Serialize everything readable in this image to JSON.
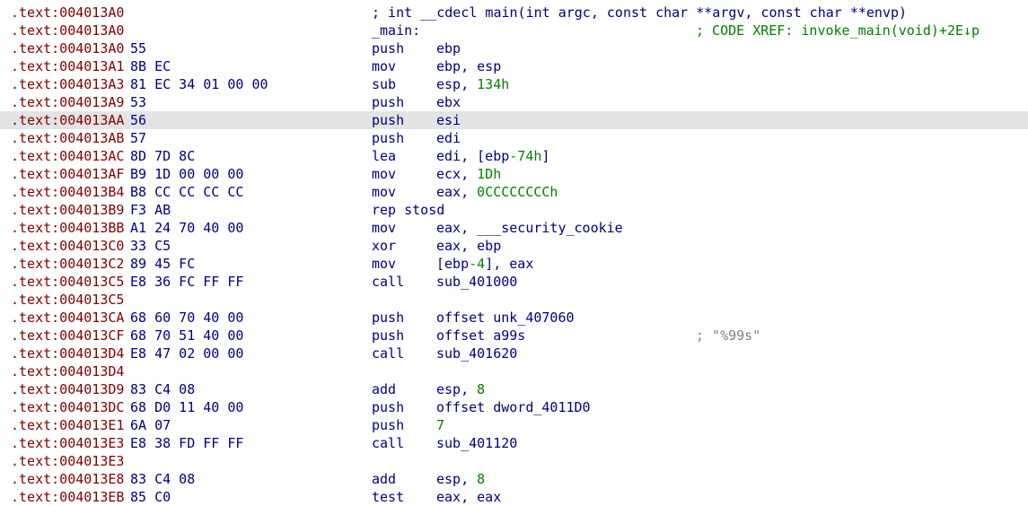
{
  "lines": [
    {
      "addr": ".text:004013A0",
      "bytes": "",
      "kind": "comment",
      "text": "; int __cdecl main(int argc, const char **argv, const char **envp)"
    },
    {
      "addr": ".text:004013A0",
      "bytes": "",
      "kind": "label",
      "text": "_main:",
      "xref": "; CODE XREF: invoke_main(void)+2E↓p"
    },
    {
      "addr": ".text:004013A0",
      "bytes": "55",
      "mnem": "push",
      "ops": [
        {
          "t": "ebp"
        }
      ]
    },
    {
      "addr": ".text:004013A1",
      "bytes": "8B EC",
      "mnem": "mov",
      "ops": [
        {
          "t": "ebp, esp"
        }
      ]
    },
    {
      "addr": ".text:004013A3",
      "bytes": "81 EC 34 01 00 00",
      "mnem": "sub",
      "ops": [
        {
          "t": "esp, "
        },
        {
          "t": "134h",
          "num": true
        }
      ]
    },
    {
      "addr": ".text:004013A9",
      "bytes": "53",
      "mnem": "push",
      "ops": [
        {
          "t": "ebx"
        }
      ]
    },
    {
      "addr": ".text:004013AA",
      "bytes": "56",
      "mnem": "push",
      "ops": [
        {
          "t": "esi"
        }
      ],
      "highlight": true
    },
    {
      "addr": ".text:004013AB",
      "bytes": "57",
      "mnem": "push",
      "ops": [
        {
          "t": "edi"
        }
      ]
    },
    {
      "addr": ".text:004013AC",
      "bytes": "8D 7D 8C",
      "mnem": "lea",
      "ops": [
        {
          "t": "edi, [ebp"
        },
        {
          "t": "-74h",
          "num": true
        },
        {
          "t": "]"
        }
      ]
    },
    {
      "addr": ".text:004013AF",
      "bytes": "B9 1D 00 00 00",
      "mnem": "mov",
      "ops": [
        {
          "t": "ecx, "
        },
        {
          "t": "1Dh",
          "num": true
        }
      ]
    },
    {
      "addr": ".text:004013B4",
      "bytes": "B8 CC CC CC CC",
      "mnem": "mov",
      "ops": [
        {
          "t": "eax, "
        },
        {
          "t": "0CCCCCCCCh",
          "num": true
        }
      ]
    },
    {
      "addr": ".text:004013B9",
      "bytes": "F3 AB",
      "mnem": "rep stosd",
      "ops": []
    },
    {
      "addr": ".text:004013BB",
      "bytes": "A1 24 70 40 00",
      "mnem": "mov",
      "ops": [
        {
          "t": "eax, ___security_cookie"
        }
      ]
    },
    {
      "addr": ".text:004013C0",
      "bytes": "33 C5",
      "mnem": "xor",
      "ops": [
        {
          "t": "eax, ebp"
        }
      ]
    },
    {
      "addr": ".text:004013C2",
      "bytes": "89 45 FC",
      "mnem": "mov",
      "ops": [
        {
          "t": "[ebp"
        },
        {
          "t": "-4",
          "num": true
        },
        {
          "t": "], eax"
        }
      ]
    },
    {
      "addr": ".text:004013C5",
      "bytes": "E8 36 FC FF FF",
      "mnem": "call",
      "ops": [
        {
          "t": "sub_401000"
        }
      ]
    },
    {
      "addr": ".text:004013C5",
      "bytes": "",
      "mnem": "",
      "ops": []
    },
    {
      "addr": ".text:004013CA",
      "bytes": "68 60 70 40 00",
      "mnem": "push",
      "ops": [
        {
          "t": "offset unk_407060"
        }
      ]
    },
    {
      "addr": ".text:004013CF",
      "bytes": "68 70 51 40 00",
      "mnem": "push",
      "ops": [
        {
          "t": "offset a99s"
        }
      ],
      "rcomment": "; \"%99s\""
    },
    {
      "addr": ".text:004013D4",
      "bytes": "E8 47 02 00 00",
      "mnem": "call",
      "ops": [
        {
          "t": "sub_401620"
        }
      ]
    },
    {
      "addr": ".text:004013D4",
      "bytes": "",
      "mnem": "",
      "ops": []
    },
    {
      "addr": ".text:004013D9",
      "bytes": "83 C4 08",
      "mnem": "add",
      "ops": [
        {
          "t": "esp, "
        },
        {
          "t": "8",
          "num": true
        }
      ]
    },
    {
      "addr": ".text:004013DC",
      "bytes": "68 D0 11 40 00",
      "mnem": "push",
      "ops": [
        {
          "t": "offset dword_4011D0"
        }
      ]
    },
    {
      "addr": ".text:004013E1",
      "bytes": "6A 07",
      "mnem": "push",
      "ops": [
        {
          "t": "7",
          "num": true
        }
      ]
    },
    {
      "addr": ".text:004013E3",
      "bytes": "E8 38 FD FF FF",
      "mnem": "call",
      "ops": [
        {
          "t": "sub_401120"
        }
      ]
    },
    {
      "addr": ".text:004013E3",
      "bytes": "",
      "mnem": "",
      "ops": []
    },
    {
      "addr": ".text:004013E8",
      "bytes": "83 C4 08",
      "mnem": "add",
      "ops": [
        {
          "t": "esp, "
        },
        {
          "t": "8",
          "num": true
        }
      ]
    },
    {
      "addr": ".text:004013EB",
      "bytes": "85 C0",
      "mnem": "test",
      "ops": [
        {
          "t": "eax, eax"
        }
      ]
    }
  ]
}
